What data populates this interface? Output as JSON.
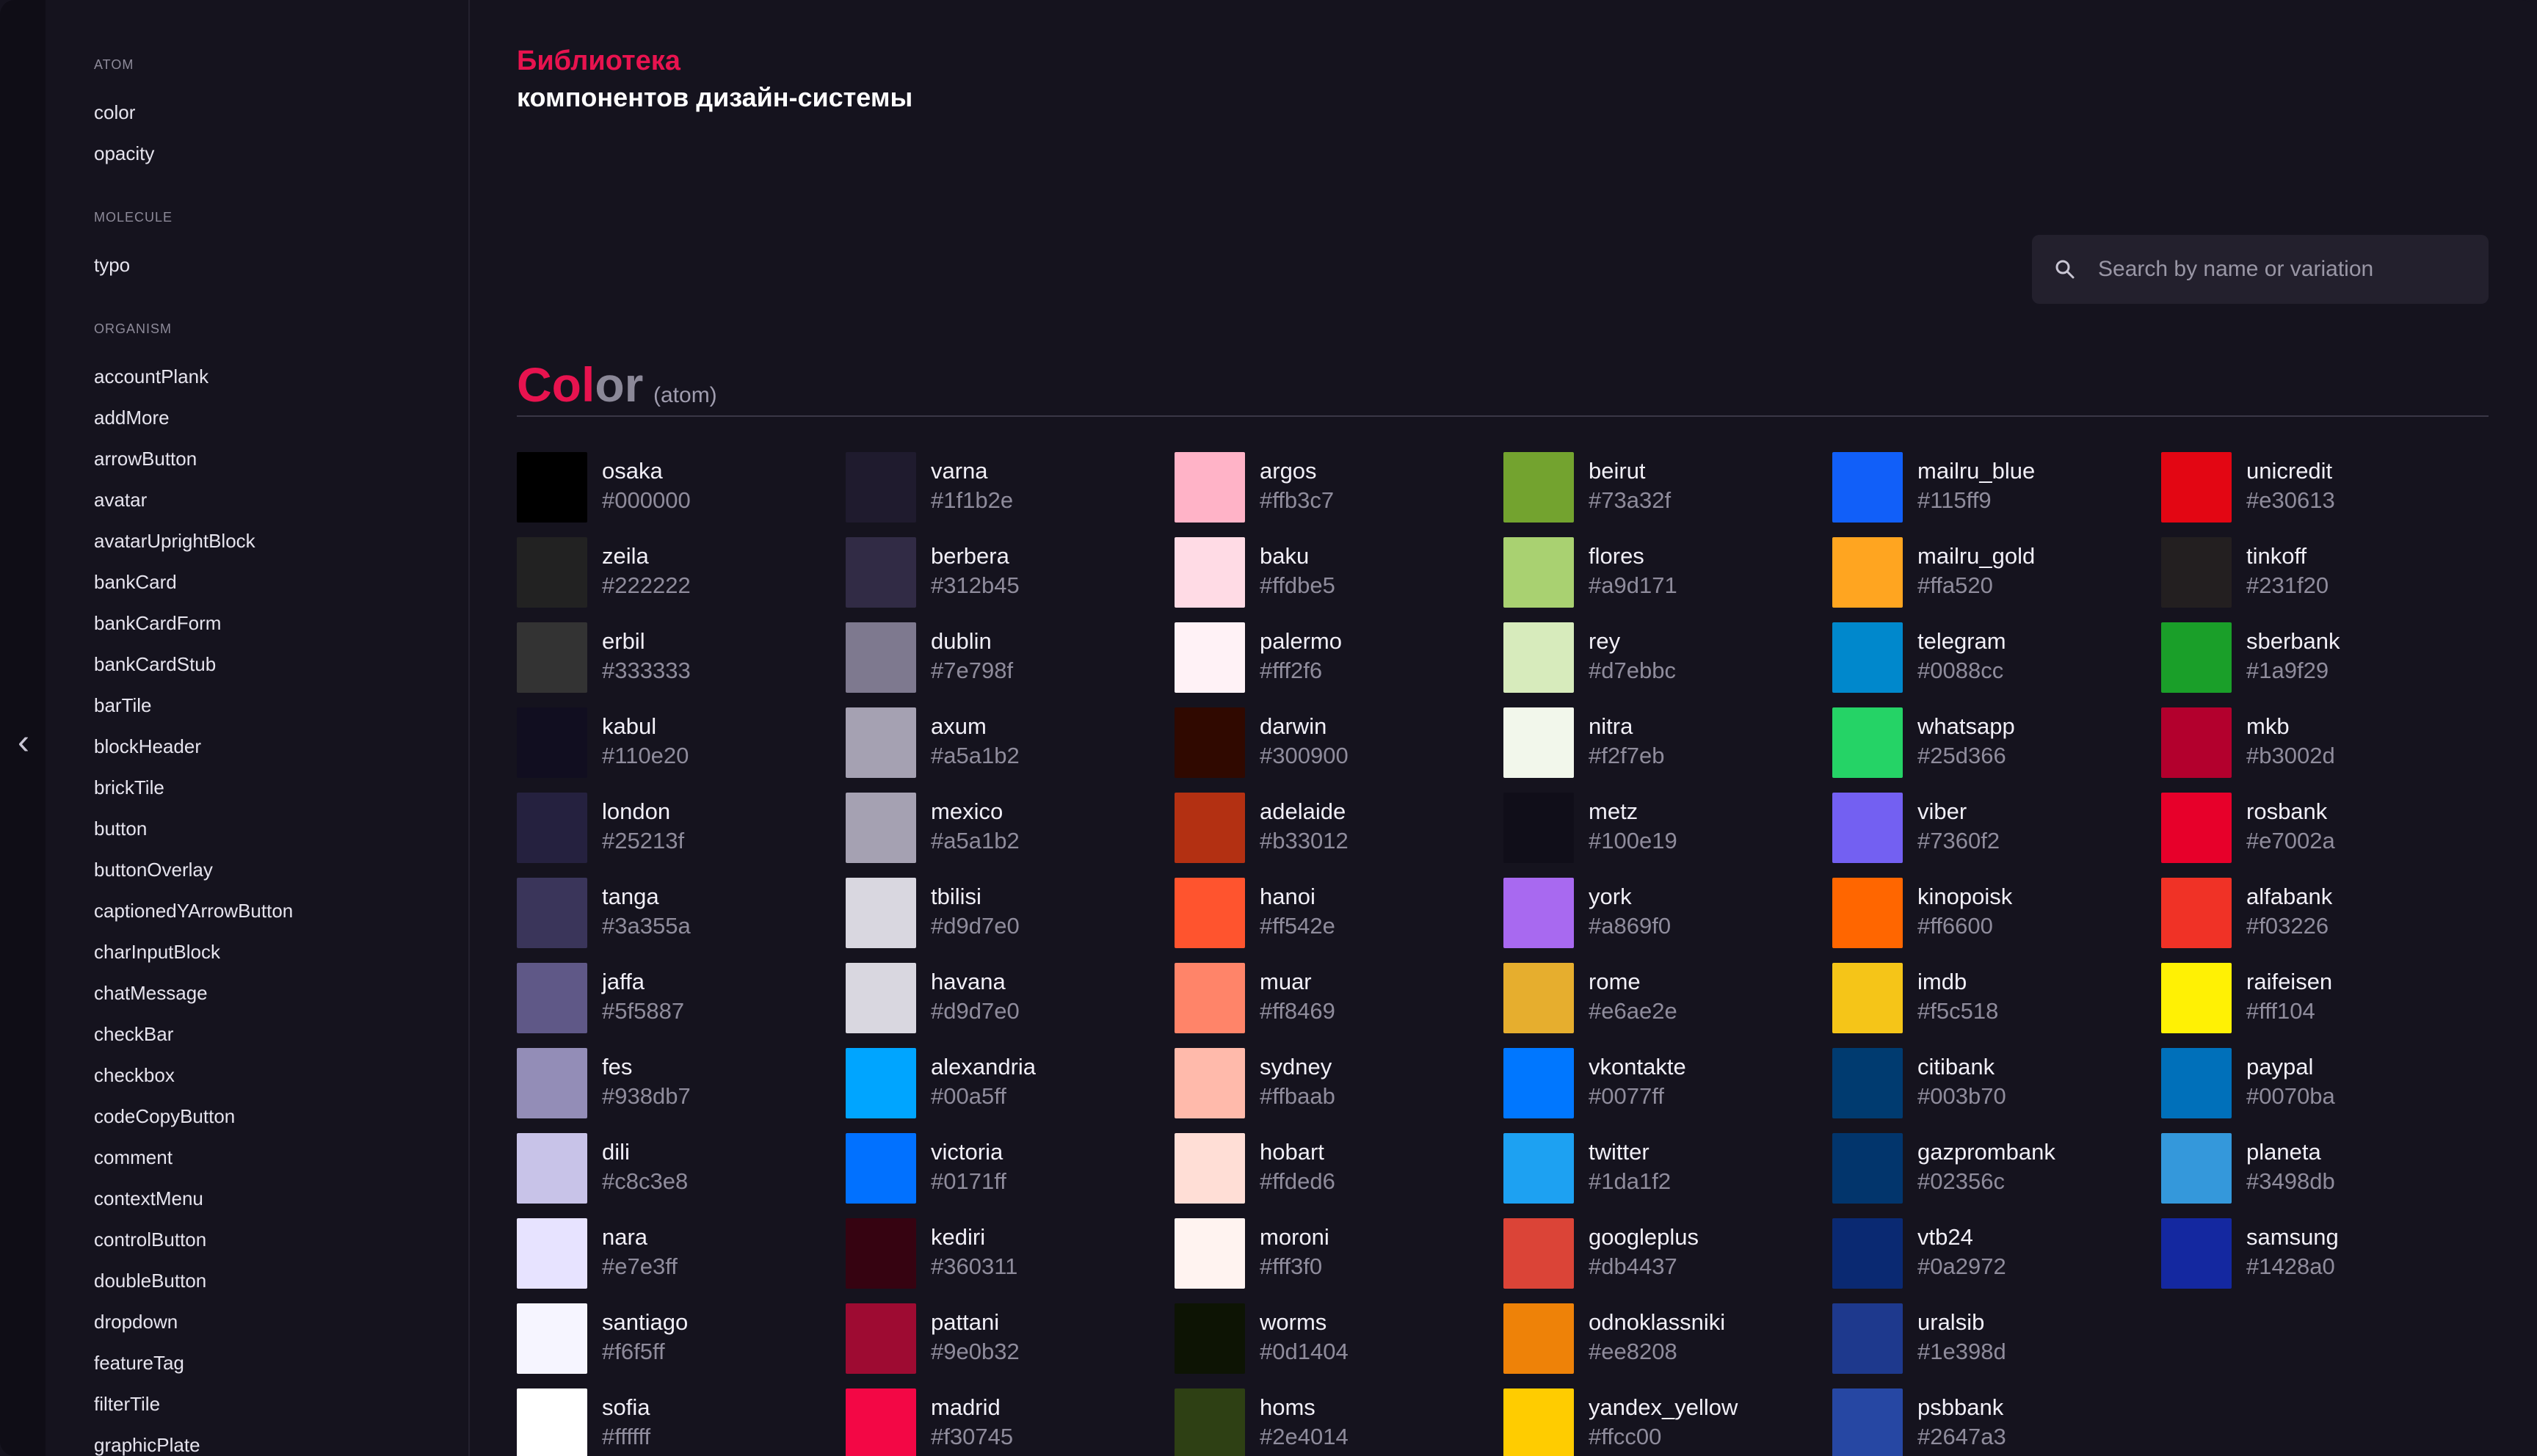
{
  "sidebar": {
    "categories": [
      {
        "label": "ATOM",
        "items": [
          "color",
          "opacity"
        ]
      },
      {
        "label": "MOLECULE",
        "items": [
          "typo"
        ]
      },
      {
        "label": "ORGANISM",
        "items": [
          "accountPlank",
          "addMore",
          "arrowButton",
          "avatar",
          "avatarUprightBlock",
          "bankCard",
          "bankCardForm",
          "bankCardStub",
          "barTile",
          "blockHeader",
          "brickTile",
          "button",
          "buttonOverlay",
          "captionedYArrowButton",
          "charInputBlock",
          "chatMessage",
          "checkBar",
          "checkbox",
          "codeCopyButton",
          "comment",
          "contextMenu",
          "controlButton",
          "doubleButton",
          "dropdown",
          "featureTag",
          "filterTile",
          "graphicPlate"
        ]
      }
    ]
  },
  "collapse_icon": "chevron-left-icon",
  "header": {
    "title_line1": "Библиотека",
    "title_line2": "компонентов дизайн-системы"
  },
  "search": {
    "placeholder": "Search by name or variation",
    "icon": "search-icon"
  },
  "section": {
    "title_part1": "Col",
    "title_part2": "or",
    "subtitle": "(atom)"
  },
  "colors": [
    [
      {
        "name": "osaka",
        "hex": "#000000"
      },
      {
        "name": "zeila",
        "hex": "#222222"
      },
      {
        "name": "erbil",
        "hex": "#333333"
      },
      {
        "name": "kabul",
        "hex": "#110e20"
      },
      {
        "name": "london",
        "hex": "#25213f"
      },
      {
        "name": "tanga",
        "hex": "#3a355a"
      },
      {
        "name": "jaffa",
        "hex": "#5f5887"
      },
      {
        "name": "fes",
        "hex": "#938db7"
      },
      {
        "name": "dili",
        "hex": "#c8c3e8"
      },
      {
        "name": "nara",
        "hex": "#e7e3ff"
      },
      {
        "name": "santiago",
        "hex": "#f6f5ff"
      },
      {
        "name": "sofia",
        "hex": "#ffffff"
      }
    ],
    [
      {
        "name": "varna",
        "hex": "#1f1b2e"
      },
      {
        "name": "berbera",
        "hex": "#312b45"
      },
      {
        "name": "dublin",
        "hex": "#7e798f"
      },
      {
        "name": "axum",
        "hex": "#a5a1b2"
      },
      {
        "name": "mexico",
        "hex": "#a5a1b2"
      },
      {
        "name": "tbilisi",
        "hex": "#d9d7e0"
      },
      {
        "name": "havana",
        "hex": "#d9d7e0"
      },
      {
        "name": "alexandria",
        "hex": "#00a5ff"
      },
      {
        "name": "victoria",
        "hex": "#0171ff"
      },
      {
        "name": "kediri",
        "hex": "#360311"
      },
      {
        "name": "pattani",
        "hex": "#9e0b32"
      },
      {
        "name": "madrid",
        "hex": "#f30745"
      }
    ],
    [
      {
        "name": "argos",
        "hex": "#ffb3c7"
      },
      {
        "name": "baku",
        "hex": "#ffdbe5"
      },
      {
        "name": "palermo",
        "hex": "#fff2f6"
      },
      {
        "name": "darwin",
        "hex": "#300900"
      },
      {
        "name": "adelaide",
        "hex": "#b33012"
      },
      {
        "name": "hanoi",
        "hex": "#ff542e"
      },
      {
        "name": "muar",
        "hex": "#ff8469"
      },
      {
        "name": "sydney",
        "hex": "#ffbaab"
      },
      {
        "name": "hobart",
        "hex": "#ffded6"
      },
      {
        "name": "moroni",
        "hex": "#fff3f0"
      },
      {
        "name": "worms",
        "hex": "#0d1404"
      },
      {
        "name": "homs",
        "hex": "#2e4014"
      }
    ],
    [
      {
        "name": "beirut",
        "hex": "#73a32f"
      },
      {
        "name": "flores",
        "hex": "#a9d171"
      },
      {
        "name": "rey",
        "hex": "#d7ebbc"
      },
      {
        "name": "nitra",
        "hex": "#f2f7eb"
      },
      {
        "name": "metz",
        "hex": "#100e19"
      },
      {
        "name": "york",
        "hex": "#a869f0"
      },
      {
        "name": "rome",
        "hex": "#e6ae2e"
      },
      {
        "name": "vkontakte",
        "hex": "#0077ff"
      },
      {
        "name": "twitter",
        "hex": "#1da1f2"
      },
      {
        "name": "googleplus",
        "hex": "#db4437"
      },
      {
        "name": "odnoklassniki",
        "hex": "#ee8208"
      },
      {
        "name": "yandex_yellow",
        "hex": "#ffcc00"
      }
    ],
    [
      {
        "name": "mailru_blue",
        "hex": "#115ff9"
      },
      {
        "name": "mailru_gold",
        "hex": "#ffa520"
      },
      {
        "name": "telegram",
        "hex": "#0088cc"
      },
      {
        "name": "whatsapp",
        "hex": "#25d366"
      },
      {
        "name": "viber",
        "hex": "#7360f2"
      },
      {
        "name": "kinopoisk",
        "hex": "#ff6600"
      },
      {
        "name": "imdb",
        "hex": "#f5c518"
      },
      {
        "name": "citibank",
        "hex": "#003b70"
      },
      {
        "name": "gazprombank",
        "hex": "#02356c"
      },
      {
        "name": "vtb24",
        "hex": "#0a2972"
      },
      {
        "name": "uralsib",
        "hex": "#1e398d"
      },
      {
        "name": "psbbank",
        "hex": "#2647a3"
      }
    ],
    [
      {
        "name": "unicredit",
        "hex": "#e30613"
      },
      {
        "name": "tinkoff",
        "hex": "#231f20"
      },
      {
        "name": "sberbank",
        "hex": "#1a9f29"
      },
      {
        "name": "mkb",
        "hex": "#b3002d"
      },
      {
        "name": "rosbank",
        "hex": "#e7002a"
      },
      {
        "name": "alfabank",
        "hex": "#f03226"
      },
      {
        "name": "raifeisen",
        "hex": "#fff104"
      },
      {
        "name": "paypal",
        "hex": "#0070ba"
      },
      {
        "name": "planeta",
        "hex": "#3498db"
      },
      {
        "name": "samsung",
        "hex": "#1428a0"
      }
    ]
  ]
}
